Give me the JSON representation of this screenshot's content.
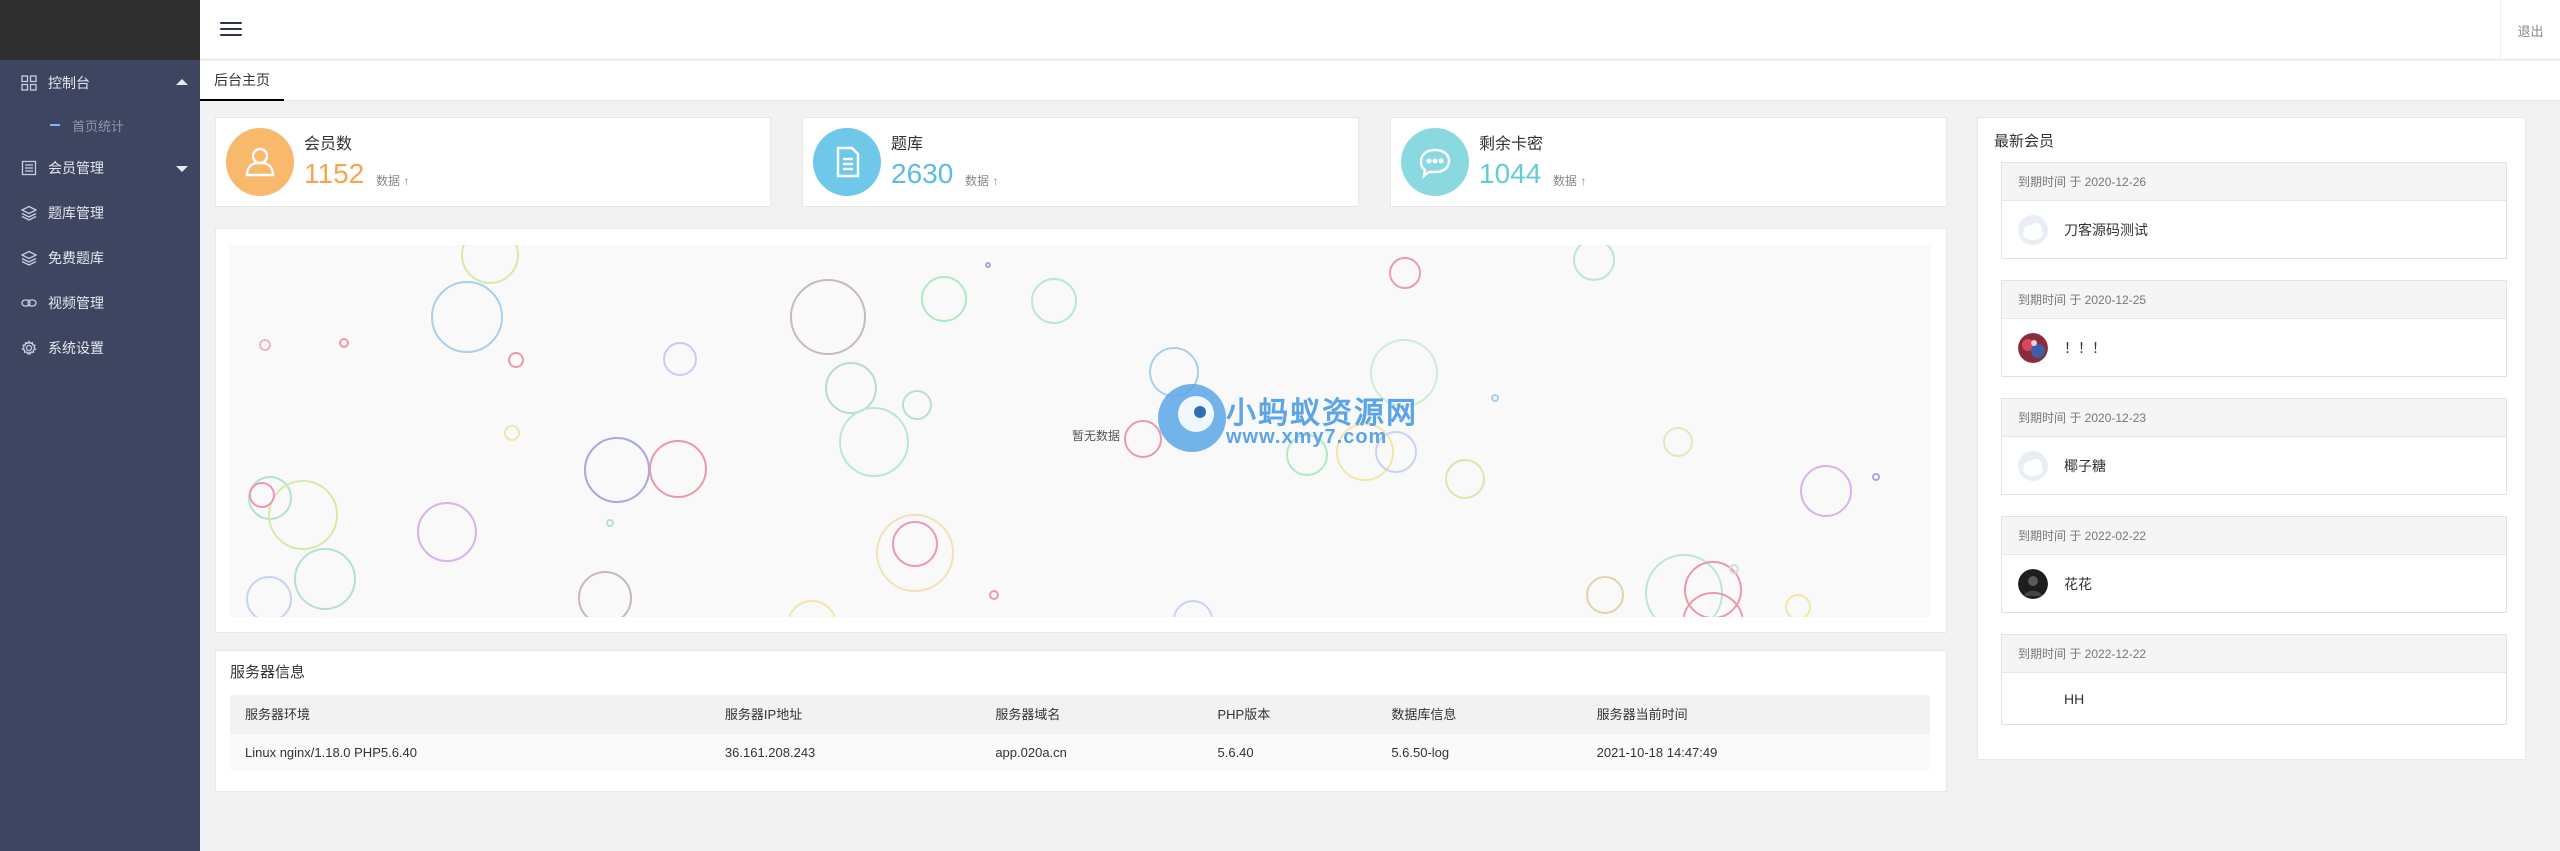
{
  "sidebar": {
    "items": [
      {
        "label": "控制台",
        "icon": "grid-icon",
        "expanded": true
      },
      {
        "label": "会员管理",
        "icon": "list-icon",
        "expanded": false
      },
      {
        "label": "题库管理",
        "icon": "layers-icon"
      },
      {
        "label": "免费题库",
        "icon": "layers-icon"
      },
      {
        "label": "视频管理",
        "icon": "link-icon"
      },
      {
        "label": "系统设置",
        "icon": "gear-icon"
      }
    ],
    "subitems": [
      {
        "label": "首页统计"
      }
    ]
  },
  "header": {
    "logout_label": "退出"
  },
  "tabs": [
    {
      "label": "后台主页",
      "active": true
    }
  ],
  "stats": [
    {
      "label": "会员数",
      "value": "1152",
      "sub": "数据 ↑",
      "color": "#f9b96c",
      "value_color": "#f6a54f",
      "icon": "user-icon"
    },
    {
      "label": "题库",
      "value": "2630",
      "sub": "数据 ↑",
      "color": "#6fc8ea",
      "value_color": "#5bbbe8",
      "icon": "document-icon"
    },
    {
      "label": "剩余卡密",
      "value": "1044",
      "sub": "数据 ↑",
      "color": "#8ad9e0",
      "value_color": "#62cdd6",
      "icon": "chat-icon"
    }
  ],
  "chart": {
    "no_data": "暂无数据"
  },
  "watermark": {
    "line1": "小蚂蚁资源网",
    "line2": "www.xmy7.com"
  },
  "server": {
    "title": "服务器信息",
    "columns": [
      "服务器环境",
      "服务器IP地址",
      "服务器域名",
      "PHP版本",
      "数据库信息",
      "服务器当前时间"
    ],
    "row": [
      "Linux nginx/1.18.0 PHP5.6.40",
      "36.161.208.243",
      "app.020a.cn",
      "5.6.40",
      "5.6.50-log",
      "2021-10-18 14:47:49"
    ]
  },
  "members": {
    "title": "最新会员",
    "items": [
      {
        "expire": "到期时间 于 2020-12-26",
        "name": "刀客源码测试",
        "avatar": "cloud-avatar-icon"
      },
      {
        "expire": "到期时间 于 2020-12-25",
        "name": "！！！",
        "avatar": "colorful-avatar-icon"
      },
      {
        "expire": "到期时间 于 2020-12-23",
        "name": "椰子糖",
        "avatar": "cloud-avatar-icon"
      },
      {
        "expire": "到期时间 于 2022-02-22",
        "name": "花花",
        "avatar": "dark-avatar-icon"
      },
      {
        "expire": "到期时间 于 2022-12-22",
        "name": "HH",
        "avatar": "none"
      }
    ]
  },
  "colors": {
    "sidebar_bg": "#3e4561",
    "sidebar_logo_bg": "#2f2f2f",
    "submenu_accent": "#7fb6ff"
  }
}
